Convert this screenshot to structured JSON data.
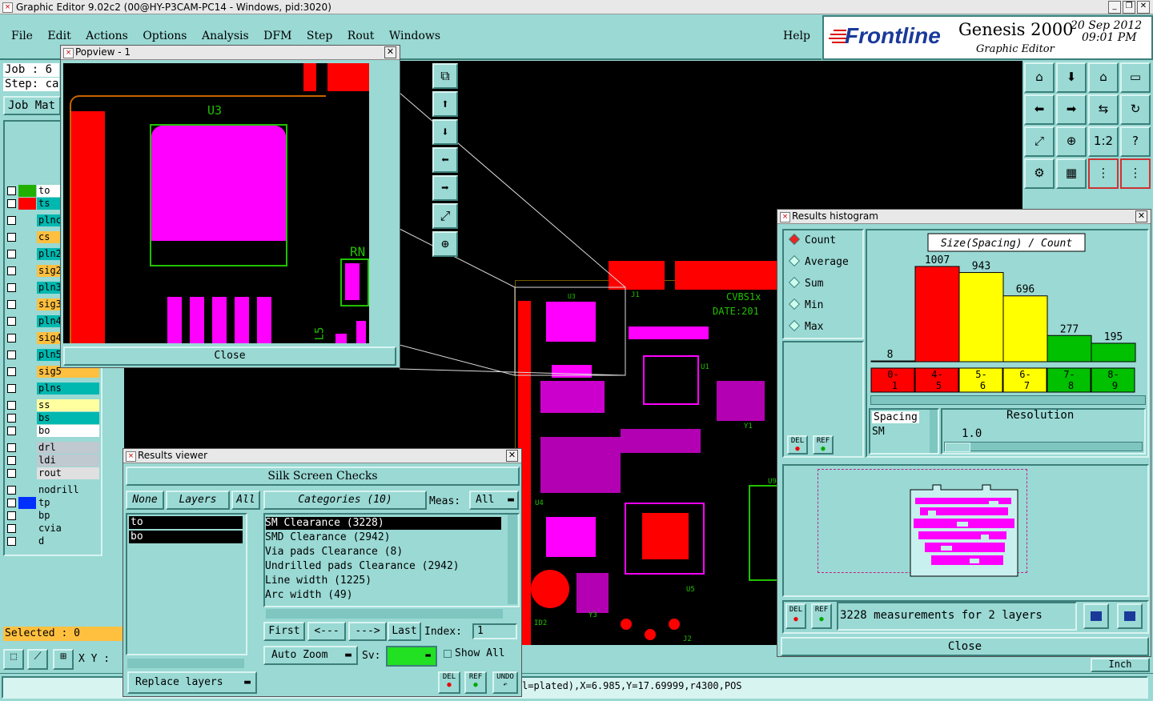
{
  "window_title": "Graphic Editor 9.02c2 (00@HY-P3CAM-PC14 - Windows, pid:3020)",
  "menu": [
    "File",
    "Edit",
    "Actions",
    "Options",
    "Analysis",
    "DFM",
    "Step",
    "Rout",
    "Windows"
  ],
  "help": "Help",
  "brand": {
    "logo": "Frontline",
    "product": "Genesis 2000",
    "sub": "Graphic Editor",
    "date": "20 Sep 2012",
    "time": "09:01 PM"
  },
  "job": {
    "job_label": "Job : 6",
    "step_label": "Step: ca",
    "matrix_button": "Job Mat"
  },
  "layers": [
    {
      "name": "to",
      "color": "#22b000",
      "bg": "#ffffff"
    },
    {
      "name": "ts",
      "color": "#ff0000",
      "bg": "#00b8b0"
    },
    {
      "name": "plnc",
      "color": "",
      "bg": "#00b8b0"
    },
    {
      "name": "cs",
      "color": "",
      "bg": "#ffc040"
    },
    {
      "name": "pln2",
      "color": "",
      "bg": "#00b8b0"
    },
    {
      "name": "sig2",
      "color": "",
      "bg": "#ffc040"
    },
    {
      "name": "pln3",
      "color": "",
      "bg": "#00b8b0"
    },
    {
      "name": "sig3",
      "color": "",
      "bg": "#ffc040"
    },
    {
      "name": "pln4",
      "color": "",
      "bg": "#00b8b0"
    },
    {
      "name": "sig4",
      "color": "",
      "bg": "#ffc040"
    },
    {
      "name": "pln5",
      "color": "",
      "bg": "#00b8b0"
    },
    {
      "name": "sig5",
      "color": "",
      "bg": "#ffc040"
    },
    {
      "name": "plns",
      "color": "",
      "bg": "#00b8b0"
    },
    {
      "name": "ss",
      "color": "",
      "bg": "#ffffa0"
    },
    {
      "name": "bs",
      "color": "",
      "bg": "#00b8b0"
    },
    {
      "name": "bo",
      "color": "",
      "bg": "#ffffff"
    },
    {
      "name": "drl",
      "color": "",
      "bg": "#c0c8d0"
    },
    {
      "name": "ldi",
      "color": "",
      "bg": "#c0c8d0"
    },
    {
      "name": "rout",
      "color": "",
      "bg": "#e0e0e0"
    },
    {
      "name": "nodrill",
      "color": "",
      "bg": "#9ad9d4"
    },
    {
      "name": "tp",
      "color": "#0030ff",
      "bg": "#9ad9d4"
    },
    {
      "name": "bp",
      "color": "",
      "bg": "#9ad9d4"
    },
    {
      "name": "cvia",
      "color": "",
      "bg": "#9ad9d4"
    },
    {
      "name": "d",
      "color": "",
      "bg": "#9ad9d4"
    }
  ],
  "selected": "Selected : 0",
  "xy_label": "X Y :",
  "status_bar": "l=plated),X=6.985,Y=17.69999,r4300,POS",
  "units_button": "Inch",
  "popview": {
    "title": "Popview - 1",
    "close": "Close",
    "labels": {
      "u3": "U3",
      "rn": "RN",
      "l5": "L5"
    }
  },
  "board_labels": {
    "ref": "CVBS1x",
    "date": "DATE:201",
    "j1": "J1",
    "j2": "J2",
    "u3": "U3",
    "u4": "U4",
    "u5": "U5",
    "u1": "U1",
    "y1": "Y1",
    "y3": "Y3",
    "id2": "ID2",
    "u9": "U9"
  },
  "results_viewer": {
    "title": "Results viewer",
    "header": "Silk Screen Checks",
    "none": "None",
    "layers": "Layers",
    "all": "All",
    "layer_list": [
      "to",
      "bo"
    ],
    "categories_label": "Categories (10)",
    "meas_label": "Meas:",
    "meas_value": "All",
    "categories": [
      "SM Clearance (3228)",
      "SMD Clearance (2942)",
      "Via pads Clearance (8)",
      "Undrilled pads Clearance (2942)",
      "Line width (1225)",
      "Arc width (49)"
    ],
    "first": "First",
    "prev": "<---",
    "next": "--->",
    "last": "Last",
    "index_label": "Index:",
    "index_value": "1",
    "auto_zoom": "Auto Zoom",
    "sv_label": "Sv:",
    "show_all": "Show All",
    "replace_layers": "Replace layers",
    "del": "DEL",
    "ref": "REF",
    "undo": "UNDO"
  },
  "histogram": {
    "title": "Results histogram",
    "modes": [
      "Count",
      "Average",
      "Sum",
      "Min",
      "Max"
    ],
    "selected_mode": "Count",
    "chart_title": "Size(Spacing) / Count",
    "del": "DEL",
    "ref": "REF",
    "param_label": "Spacing",
    "param_value": "SM",
    "resolution_label": "Resolution",
    "resolution_value": "1.0",
    "summary": "3228 measurements for 2 layers",
    "close": "Close"
  },
  "chart_data": {
    "type": "bar",
    "title": "Size(Spacing) / Count",
    "categories": [
      "0-1",
      "4-5",
      "5-6",
      "6-7",
      "7-8",
      "8-9"
    ],
    "category_labels": [
      [
        "0-",
        "1"
      ],
      [
        "4-",
        "5"
      ],
      [
        "5-",
        "6"
      ],
      [
        "6-",
        "7"
      ],
      [
        "7-",
        "8"
      ],
      [
        "8-",
        "9"
      ]
    ],
    "values": [
      8,
      1007,
      943,
      696,
      277,
      195
    ],
    "colors": [
      "#ff0000",
      "#ff0000",
      "#ffff00",
      "#ffff00",
      "#00c000",
      "#00c000"
    ],
    "ylim": [
      0,
      1100
    ]
  }
}
